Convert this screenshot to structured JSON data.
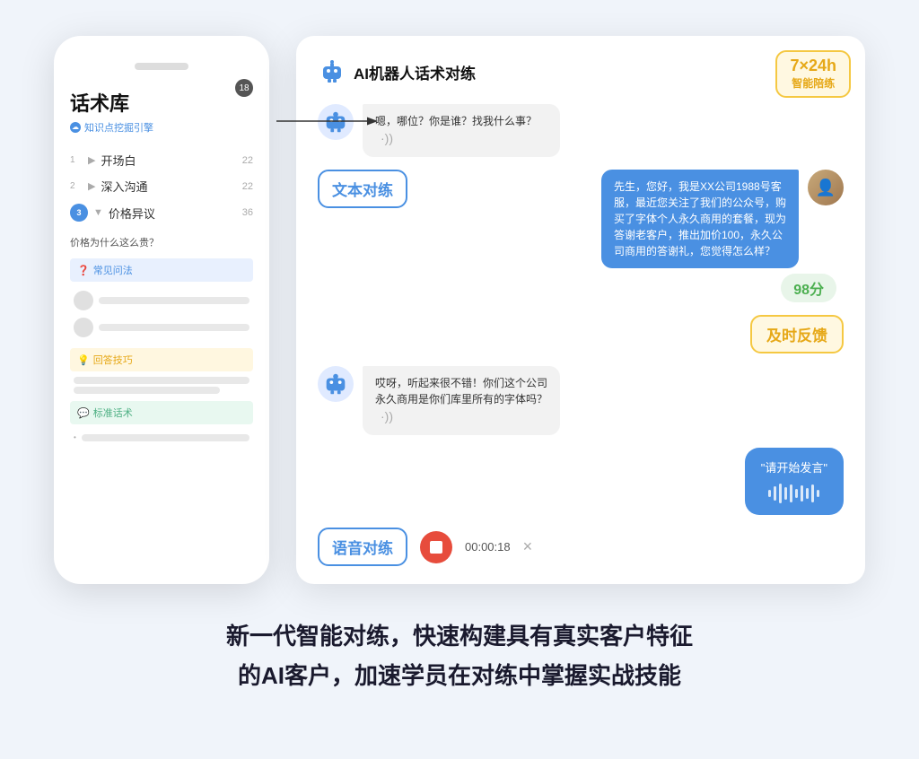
{
  "page": {
    "bg_color": "#f0f4fa"
  },
  "phone": {
    "title": "话术库",
    "subtitle": "知识点挖掘引擎",
    "badge": "18",
    "nav_items": [
      {
        "num": "1",
        "label": "开场白",
        "count": "22",
        "active": false
      },
      {
        "num": "2",
        "label": "深入沟通",
        "count": "22",
        "active": false
      },
      {
        "num": "3",
        "label": "价格异议",
        "count": "36",
        "active": true
      }
    ],
    "question": "价格为什么这么贵？",
    "sections": [
      {
        "label": "常见问法",
        "type": "blue"
      },
      {
        "label": "回答技巧",
        "type": "yellow"
      },
      {
        "label": "标准话术",
        "type": "green"
      }
    ]
  },
  "chat": {
    "title": "AI机器人话术对练",
    "badge_7x24": {
      "line1": "7×24h",
      "line2": "智能陪练"
    },
    "messages": [
      {
        "side": "left",
        "type": "robot",
        "text": "嗯，哪位？你是谁？找我什么事？"
      },
      {
        "side": "right",
        "type": "human",
        "text": "先生，您好，我是XX公司1988号客服，最近您关注了我们的公众号，购买了字体个人永久商用的套餐，现为答谢老客户，推出加价100，永久公司商用的答谢礼，您觉得怎么样？"
      }
    ],
    "text_practice_label": "文本对练",
    "score": "98分",
    "feedback_label": "及时反馈",
    "robot_msg2": "哎呀，听起来很不错！你们这个公司永久商用是你们库里所有的字体吗？",
    "voice_bubble_text": "\"请开始发言\"",
    "voice_practice_label": "语音对练",
    "timer": "00:00:18",
    "close_label": "×"
  },
  "bottom": {
    "text_line1": "新一代智能对练，快速构建具有真实客户特征",
    "text_line2": "的AI客户，加速学员在对练中掌握实战技能"
  },
  "arrow": {
    "label": "→"
  }
}
